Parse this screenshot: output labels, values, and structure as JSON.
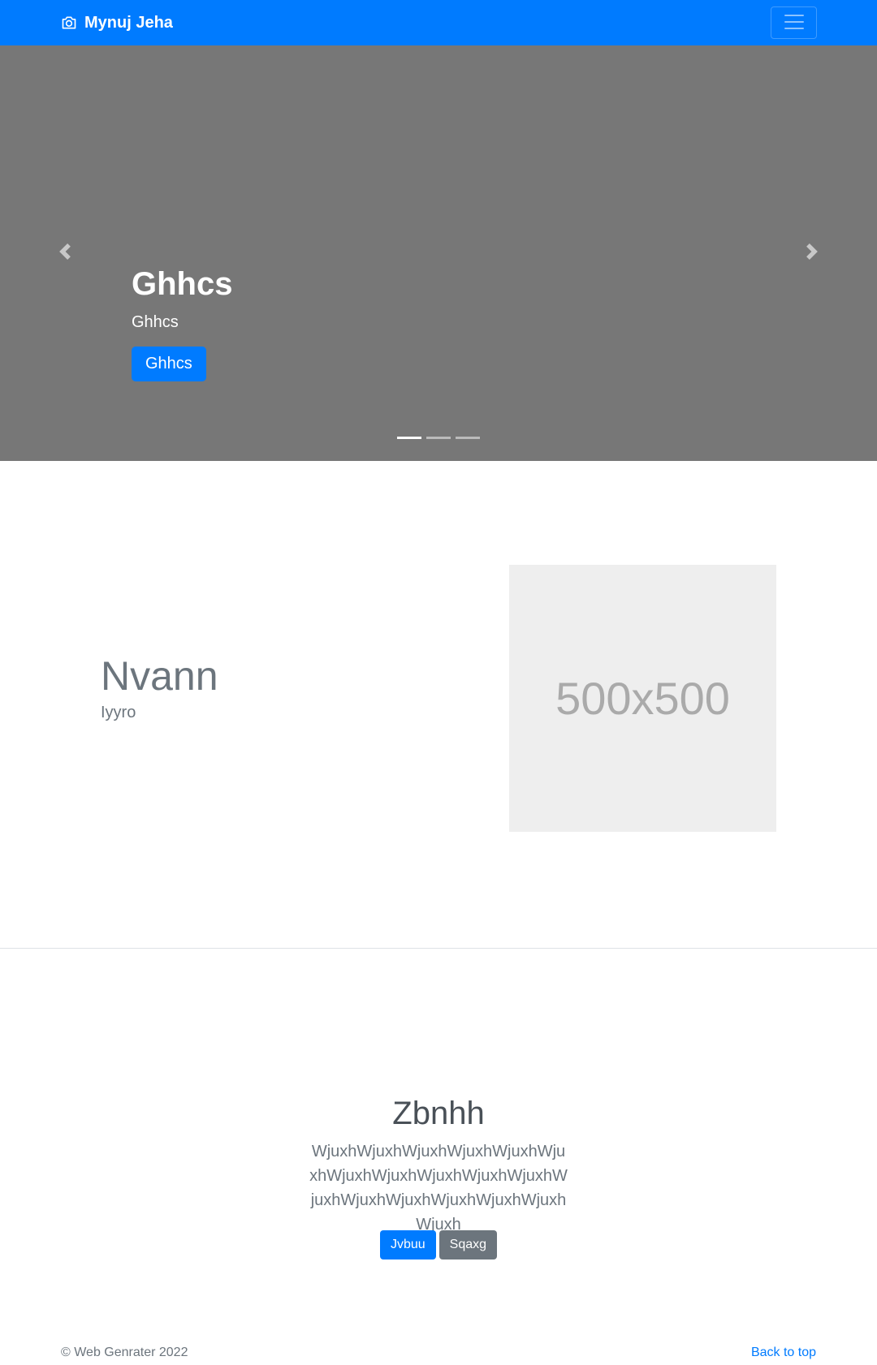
{
  "navbar": {
    "brand": "Mynuj Jeha",
    "brand_icon": "camera-icon",
    "toggler_icon": "hamburger-menu-icon",
    "color": "#007bff"
  },
  "carousel": {
    "background": "#777777",
    "title": "Ghhcs",
    "subtitle": "Ghhcs",
    "button_label": "Ghhcs",
    "prev_icon": "chevron-left-icon",
    "next_icon": "chevron-right-icon",
    "slide_count": 3,
    "active_slide": 1
  },
  "feature": {
    "heading": "Nvann",
    "lead": "Iyyro",
    "image_placeholder": "500x500"
  },
  "jumbotron": {
    "heading": "Zbnhh",
    "text": "WjuxhWjuxhWjuxhWjuxhWjuxhWjuxhWjuxhWjuxhWjuxhWjuxhWjuxhWjuxhWjuxhWjuxhWjuxhWjuxhWjuxhWjuxh",
    "primary_button": "Jvbuu",
    "secondary_button": "Sqaxg"
  },
  "footer": {
    "copyright": "© Web Genrater 2022",
    "back_to_top": "Back to top"
  }
}
